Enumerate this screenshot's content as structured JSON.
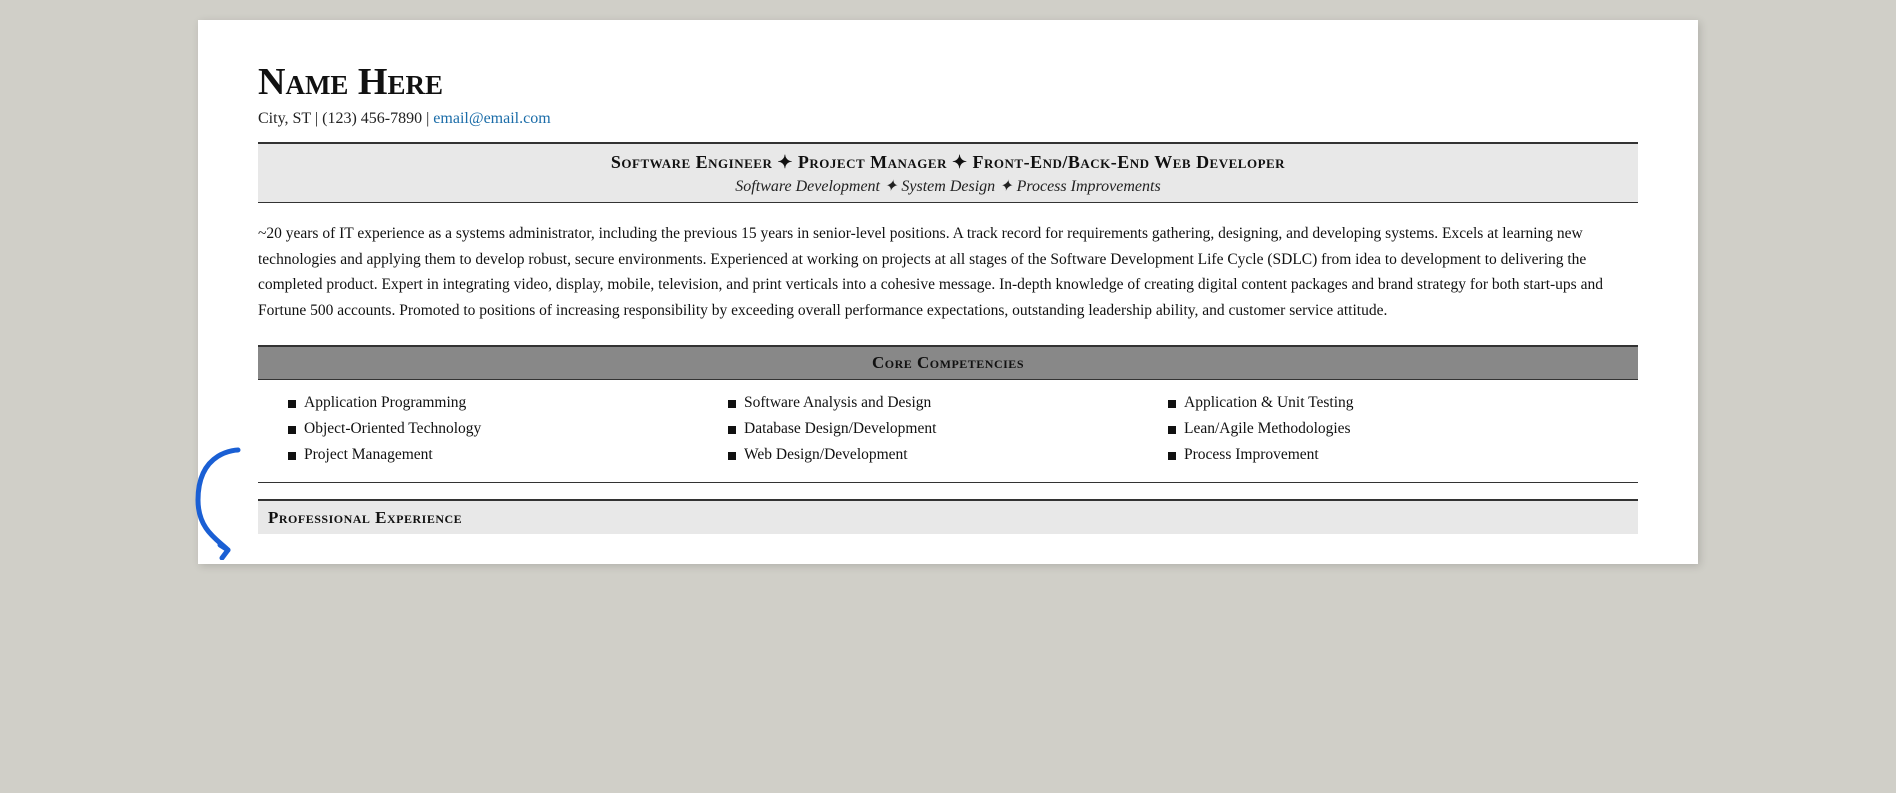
{
  "header": {
    "name": "Name Here",
    "city": "City, ST",
    "phone": "(123) 456-7890",
    "email": "email@email.com",
    "email_href": "mailto:email@email.com"
  },
  "title_banner": {
    "main": "Software Engineer ✦ Project Manager ✦ Front-End/Back-End Web Developer",
    "sub": "Software Development ✦ System Design ✦ Process Improvements",
    "diamond": "✦"
  },
  "summary": "~20 years of IT experience as a systems administrator, including the previous 15 years in senior-level positions. A track record for requirements gathering, designing, and developing systems. Excels at learning new technologies and applying them to develop robust, secure environments. Experienced at working on projects at all stages of the Software Development Life Cycle (SDLC) from idea to development to delivering the completed product. Expert in integrating video, display, mobile, television, and print verticals into a cohesive message. In-depth knowledge of creating digital content packages and brand strategy for both start-ups and Fortune 500 accounts. Promoted to positions of increasing responsibility by exceeding overall performance expectations, outstanding leadership ability, and customer service attitude.",
  "competencies": {
    "section_title": "Core Competencies",
    "columns": [
      {
        "items": [
          "Application Programming",
          "Object-Oriented Technology",
          "Project Management"
        ]
      },
      {
        "items": [
          "Software Analysis and Design",
          "Database Design/Development",
          "Web Design/Development"
        ]
      },
      {
        "items": [
          "Application & Unit Testing",
          "Lean/Agile Methodologies",
          "Process Improvement"
        ]
      }
    ]
  },
  "professional_experience": {
    "section_title": "Professional Experience"
  }
}
